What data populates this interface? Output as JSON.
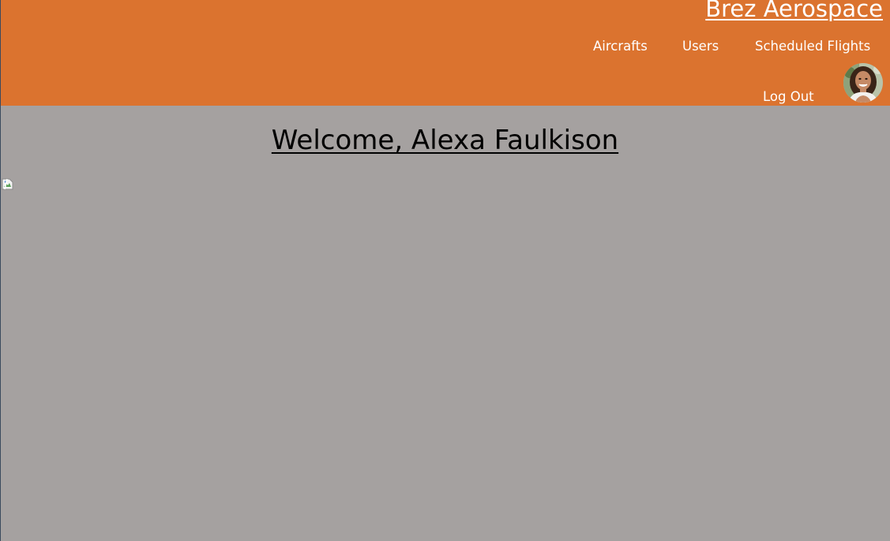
{
  "header": {
    "brand": "Brez Aerospace",
    "background_color": "#db732f",
    "nav": {
      "aircrafts": "Aircrafts",
      "users": "Users",
      "scheduled_flights": "Scheduled Flights",
      "log_out": "Log Out"
    },
    "avatar_icon": "user-avatar-photo"
  },
  "main": {
    "welcome": "Welcome, Alexa Faulkison",
    "background_color": "#a5a1a0",
    "image_icon": "broken-image-icon"
  }
}
